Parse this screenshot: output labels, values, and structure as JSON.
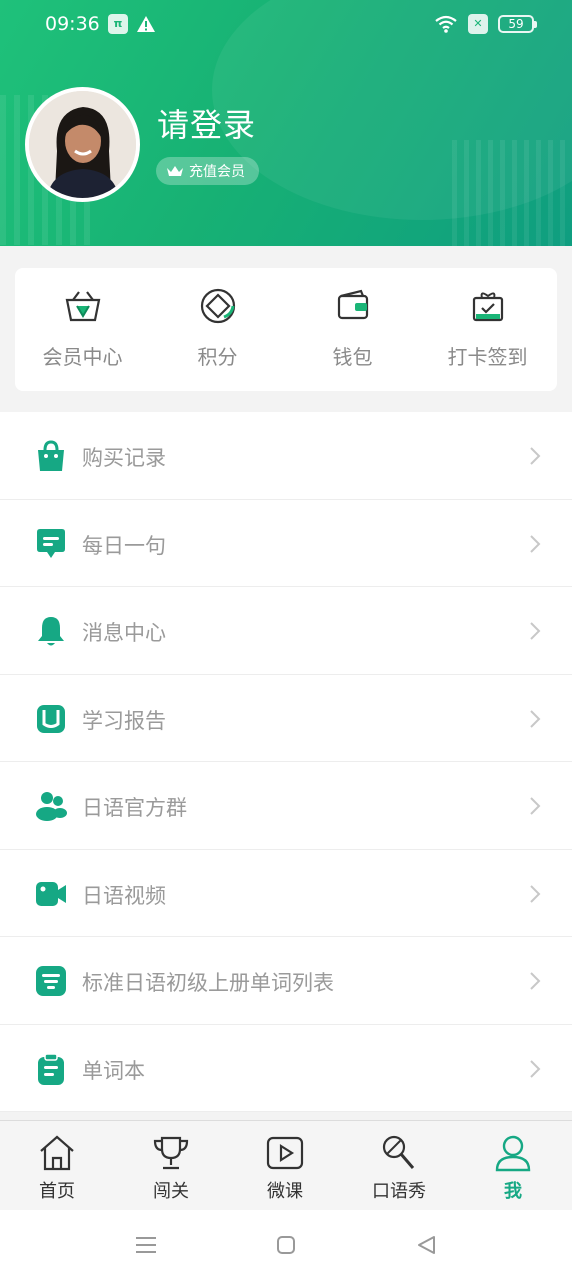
{
  "status": {
    "time": "09:36",
    "battery": "59"
  },
  "profile": {
    "title": "请登录",
    "vip_label": "充值会员"
  },
  "quick": [
    {
      "label": "会员中心",
      "icon": "vip-basket-icon"
    },
    {
      "label": "积分",
      "icon": "points-diamond-icon"
    },
    {
      "label": "钱包",
      "icon": "wallet-icon"
    },
    {
      "label": "打卡签到",
      "icon": "checkin-gift-icon"
    }
  ],
  "menu": [
    {
      "label": "购买记录",
      "icon": "shopping-bag-icon"
    },
    {
      "label": "每日一句",
      "icon": "chat-bubble-icon"
    },
    {
      "label": "消息中心",
      "icon": "bell-icon"
    },
    {
      "label": "学习报告",
      "icon": "report-icon"
    },
    {
      "label": "日语官方群",
      "icon": "group-icon"
    },
    {
      "label": "日语视频",
      "icon": "video-camera-icon"
    },
    {
      "label": "标准日语初级上册单词列表",
      "icon": "list-filter-icon"
    },
    {
      "label": "单词本",
      "icon": "clipboard-icon"
    }
  ],
  "nav": [
    {
      "label": "首页",
      "icon": "home-icon"
    },
    {
      "label": "闯关",
      "icon": "trophy-icon"
    },
    {
      "label": "微课",
      "icon": "play-icon"
    },
    {
      "label": "口语秀",
      "icon": "microphone-icon"
    },
    {
      "label": "我",
      "icon": "person-icon"
    }
  ],
  "colors": {
    "primary": "#1ab577",
    "accent": "#16a884",
    "text_muted": "#9a9a9a"
  }
}
